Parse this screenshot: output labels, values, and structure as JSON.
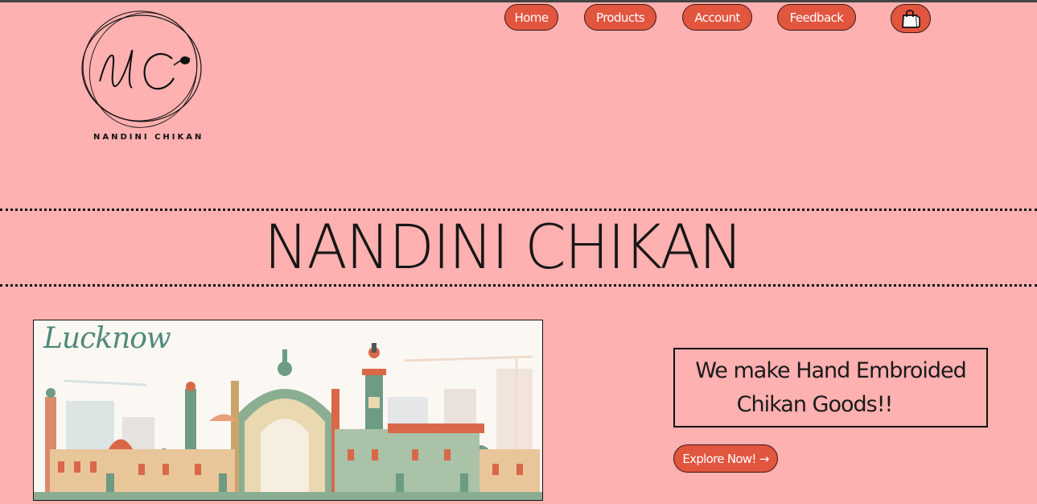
{
  "logo": {
    "monogram": "NC",
    "text": "NANDINI CHIKAN"
  },
  "nav": {
    "home": "Home",
    "products": "Products",
    "account": "Account",
    "feedback": "Feedback",
    "cart_icon": "shopping-bag-icon"
  },
  "hero": {
    "title": "NANDINI CHIKAN"
  },
  "banner": {
    "word": "Lucknow"
  },
  "tagline": {
    "line1": "We make Hand Embroided",
    "line2": "Chikan Goods!!"
  },
  "cta": {
    "label": "Explore Now! →"
  },
  "colors": {
    "background": "#ffb0b0",
    "button": "#e2553f",
    "text": "#161616"
  }
}
